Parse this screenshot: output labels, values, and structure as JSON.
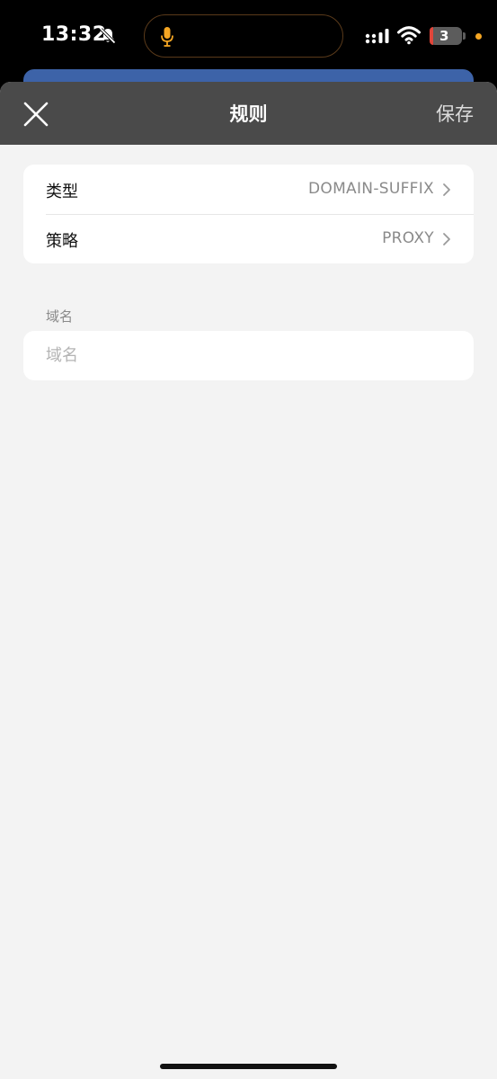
{
  "status_bar": {
    "time": "13:32",
    "battery_level": "3"
  },
  "nav": {
    "title": "规则",
    "save_label": "保存"
  },
  "rule": {
    "type_label": "类型",
    "type_value": "DOMAIN-SUFFIX",
    "policy_label": "策略",
    "policy_value": "PROXY"
  },
  "domain": {
    "section_label": "域名",
    "placeholder": "域名",
    "value": ""
  },
  "colors": {
    "nav_bar": "#4a4a4a",
    "sheet_bg": "#f3f3f3",
    "peek_card": "#3d63a8",
    "mic_accent": "#f5a623"
  },
  "icons": {
    "close": "close-icon",
    "chevron": "chevron-right-icon",
    "mic": "microphone-icon",
    "bell": "bell-slash-icon",
    "wifi": "wifi-icon",
    "signal": "cellular-signal-icon"
  }
}
